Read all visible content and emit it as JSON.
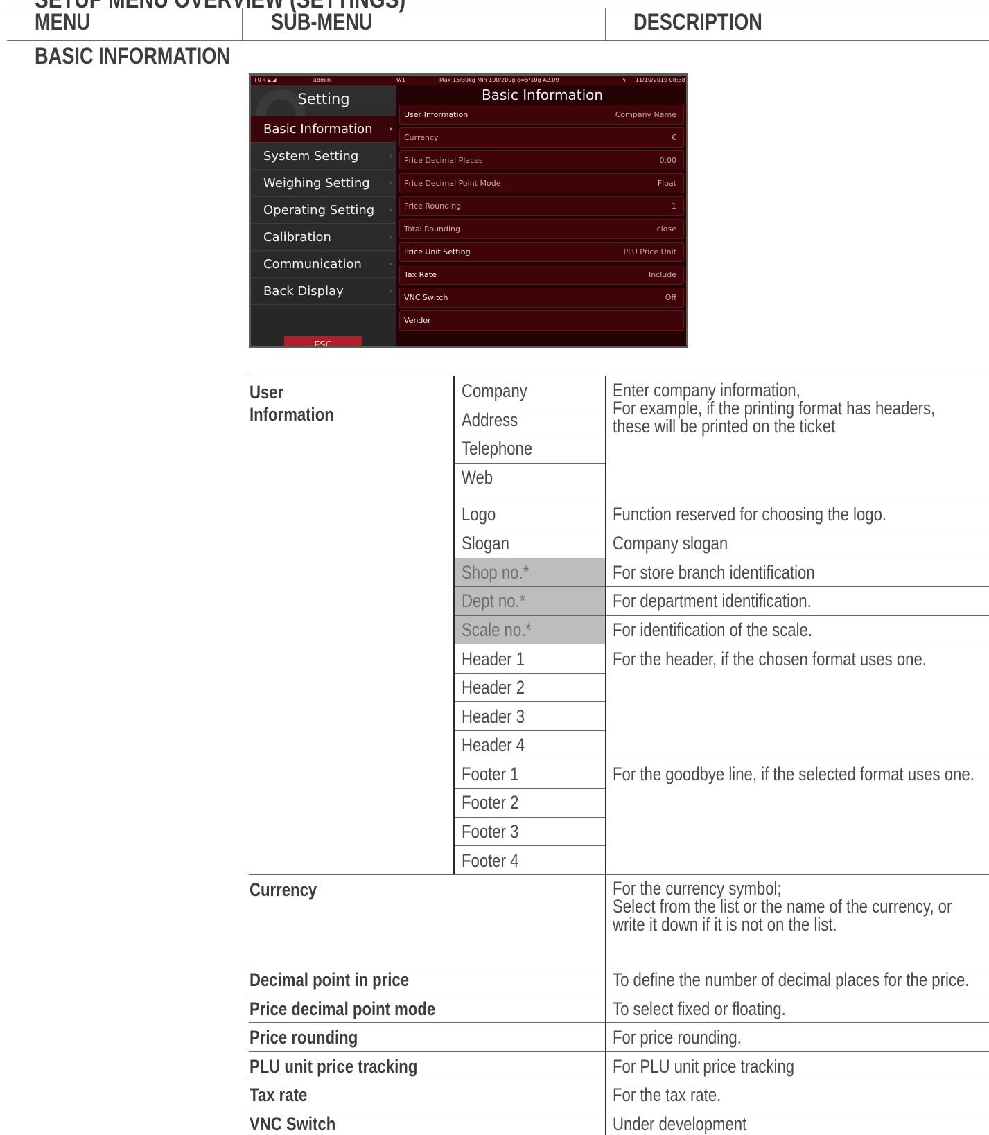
{
  "page_title": "SETUP MENU OVERVIEW (SETTINGS)",
  "columns": {
    "menu": "MENU",
    "submenu": "SUB-MENU",
    "description": "DESCRIPTION"
  },
  "section_title": "BASIC INFORMATION",
  "device": {
    "status": {
      "icons": "+0 ←◣◢",
      "user": "admin",
      "w": "W1",
      "range": "Max 15/30kg   Min 100/200g e=5/10g A2.09",
      "power": "ϟ",
      "datetime": "11/10/2019 08:38"
    },
    "sidebar_title": "Setting",
    "menu": [
      "Basic Information",
      "System Setting",
      "Weighing Setting",
      "Operating Setting",
      "Calibration",
      "Communication",
      "Back Display"
    ],
    "chevron": "›",
    "esc": "ESC",
    "panel_title": "Basic Information",
    "rows": [
      {
        "key": "User Information",
        "value": "Company Name"
      },
      {
        "key": "Currency",
        "value": "€"
      },
      {
        "key": "Price Decimal Places",
        "value": "0.00"
      },
      {
        "key": "Price Decimal Point Mode",
        "value": "Float"
      },
      {
        "key": "Price Rounding",
        "value": "1"
      },
      {
        "key": "Total Rounding",
        "value": "close"
      },
      {
        "key": "Price Unit Setting",
        "value": "PLU Price Unit"
      },
      {
        "key": "Tax Rate",
        "value": "Include"
      },
      {
        "key": "VNC Switch",
        "value": "Off"
      },
      {
        "key": "Vendor",
        "value": ""
      }
    ]
  },
  "table": {
    "user_information": "User\nInformation",
    "submenus": [
      "Company",
      "Address",
      "Telephone",
      "Web",
      "Logo",
      "Slogan",
      "Shop no.*",
      "Dept no.*",
      "Scale no.*",
      "Header 1",
      "Header 2",
      "Header 3",
      "Header 4",
      "Footer 1",
      "Footer 2",
      "Footer 3",
      "Footer 4"
    ],
    "descriptions": {
      "company_block": "Enter company information,\nFor example, if the printing format has headers, these will be printed on the ticket",
      "logo": "Function reserved for choosing the logo.",
      "slogan": "Company slogan",
      "shop": "For store branch identification",
      "dept": "For department identification.",
      "scale": "For identification of the scale.",
      "header": "For the header, if the chosen format uses one.",
      "footer": "For the goodbye line, if the selected format uses one."
    },
    "rows": [
      {
        "menu": "Currency",
        "description": "For the currency symbol;\nSelect from the list or the name of the currency, or write it down if it is not on the list."
      },
      {
        "menu": "Decimal point in price",
        "description": "To define the number of decimal places for the price."
      },
      {
        "menu": "Price decimal point mode",
        "description": "To select fixed or floating."
      },
      {
        "menu": "Price rounding",
        "description": "For price rounding."
      },
      {
        "menu": "PLU unit price tracking",
        "description": "For PLU unit price tracking"
      },
      {
        "menu": "Tax rate",
        "description": "For the tax rate."
      },
      {
        "menu": "VNC Switch",
        "description": "Under development"
      }
    ]
  }
}
